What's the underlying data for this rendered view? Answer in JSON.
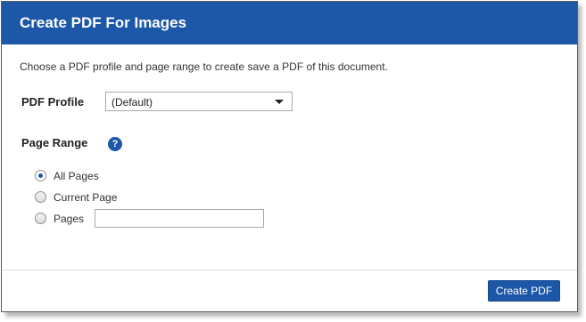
{
  "dialog": {
    "title": "Create PDF For Images",
    "intro": "Choose a PDF profile and page range to create save a PDF of this document."
  },
  "profile": {
    "label": "PDF Profile",
    "selected": "(Default)"
  },
  "page_range": {
    "label": "Page Range",
    "help_symbol": "?",
    "options": [
      {
        "label": "All Pages",
        "checked": true
      },
      {
        "label": "Current Page",
        "checked": false
      },
      {
        "label": "Pages",
        "checked": false
      }
    ],
    "pages_value": "",
    "pages_placeholder": ""
  },
  "footer": {
    "create_label": "Create PDF"
  },
  "colors": {
    "header_bg": "#1d57a8",
    "button_bg": "#1d57a8"
  }
}
